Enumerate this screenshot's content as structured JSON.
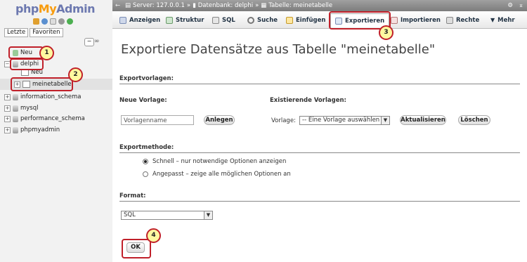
{
  "sidebar": {
    "logo": {
      "php": "php",
      "my": "My",
      "admin": "Admin"
    },
    "tabs": [
      "Letzte",
      "Favoriten"
    ],
    "tree": [
      {
        "label": "Neu"
      },
      {
        "label": "delphi"
      },
      {
        "label": "Neu"
      },
      {
        "label": "meinetabelle"
      },
      {
        "label": "information_schema"
      },
      {
        "label": "mysql"
      },
      {
        "label": "performance_schema"
      },
      {
        "label": "phpmyadmin"
      }
    ]
  },
  "topbar": {
    "server": "Server: 127.0.0.1",
    "database": "Datenbank: delphi",
    "table": "Tabelle: meinetabelle",
    "sep": "»"
  },
  "tabs": [
    {
      "label": "Anzeigen",
      "icon": "table-icon"
    },
    {
      "label": "Struktur",
      "icon": "structure-icon"
    },
    {
      "label": "SQL",
      "icon": "sql-icon"
    },
    {
      "label": "Suche",
      "icon": "search-icon"
    },
    {
      "label": "Einfügen",
      "icon": "insert-icon"
    },
    {
      "label": "Exportieren",
      "icon": "export-icon"
    },
    {
      "label": "Importieren",
      "icon": "import-icon"
    },
    {
      "label": "Rechte",
      "icon": "rights-icon"
    },
    {
      "label": "Mehr",
      "icon": "chevron-down-icon"
    }
  ],
  "main": {
    "title": "Exportiere Datensätze aus Tabelle \"meinetabelle\"",
    "templates": {
      "heading": "Exportvorlagen:",
      "new_label": "Neue Vorlage:",
      "existing_label": "Existierende Vorlagen:",
      "name_placeholder": "Vorlagenname",
      "create_btn": "Anlegen",
      "template_label": "Vorlage:",
      "template_select": "-- Eine Vorlage auswählen --",
      "update_btn": "Aktualisieren",
      "delete_btn": "Löschen"
    },
    "method": {
      "heading": "Exportmethode:",
      "quick": "Schnell – nur notwendige Optionen anzeigen",
      "custom": "Angepasst – zeige alle möglichen Optionen an"
    },
    "format": {
      "heading": "Format:",
      "value": "SQL"
    },
    "ok_btn": "OK"
  },
  "annotations": [
    "1",
    "2",
    "3",
    "4"
  ],
  "colors": {
    "highlight": "#c0202a",
    "badge_fill": "#fff9a0"
  }
}
